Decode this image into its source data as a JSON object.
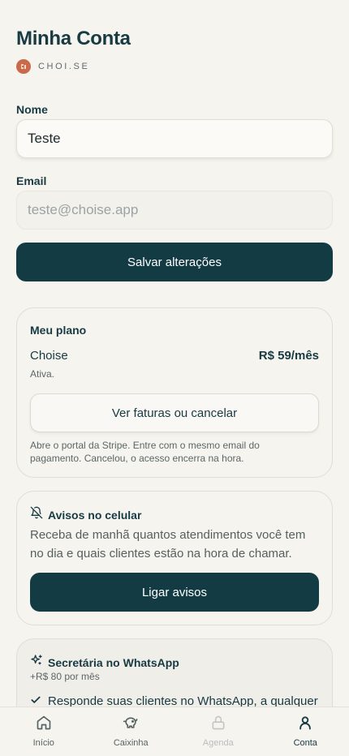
{
  "header": {
    "title": "Minha Conta",
    "brand": "CHOI.SE"
  },
  "form": {
    "name_label": "Nome",
    "name_value": "Teste",
    "email_label": "Email",
    "email_value": "teste@choise.app",
    "save_label": "Salvar alterações"
  },
  "plan": {
    "title": "Meu plano",
    "name": "Choise",
    "price": "R$ 59/mês",
    "status": "Ativa.",
    "button_label": "Ver faturas ou cancelar",
    "note": "Abre o portal da Stripe. Entre com o mesmo email do pagamento. Cancelou, o acesso encerra na hora."
  },
  "notifications": {
    "title": "Avisos no celular",
    "description": "Receba de manhã quantos atendimentos você tem no dia e quais clientes estão na hora de chamar.",
    "button_label": "Ligar avisos"
  },
  "whatsapp": {
    "title": "Secretária no WhatsApp",
    "price": "+R$ 80 por mês",
    "features": [
      "Responde suas clientes no WhatsApp, a qualquer"
    ]
  },
  "tabbar": {
    "items": [
      {
        "label": "Início",
        "icon": "home-icon"
      },
      {
        "label": "Caixinha",
        "icon": "piggy-bank-icon"
      },
      {
        "label": "Agenda",
        "icon": "lock-icon"
      },
      {
        "label": "Conta",
        "icon": "user-icon"
      }
    ]
  },
  "colors": {
    "primary": "#133b44",
    "background": "#f6f4ef",
    "brand": "#c96a4a"
  }
}
